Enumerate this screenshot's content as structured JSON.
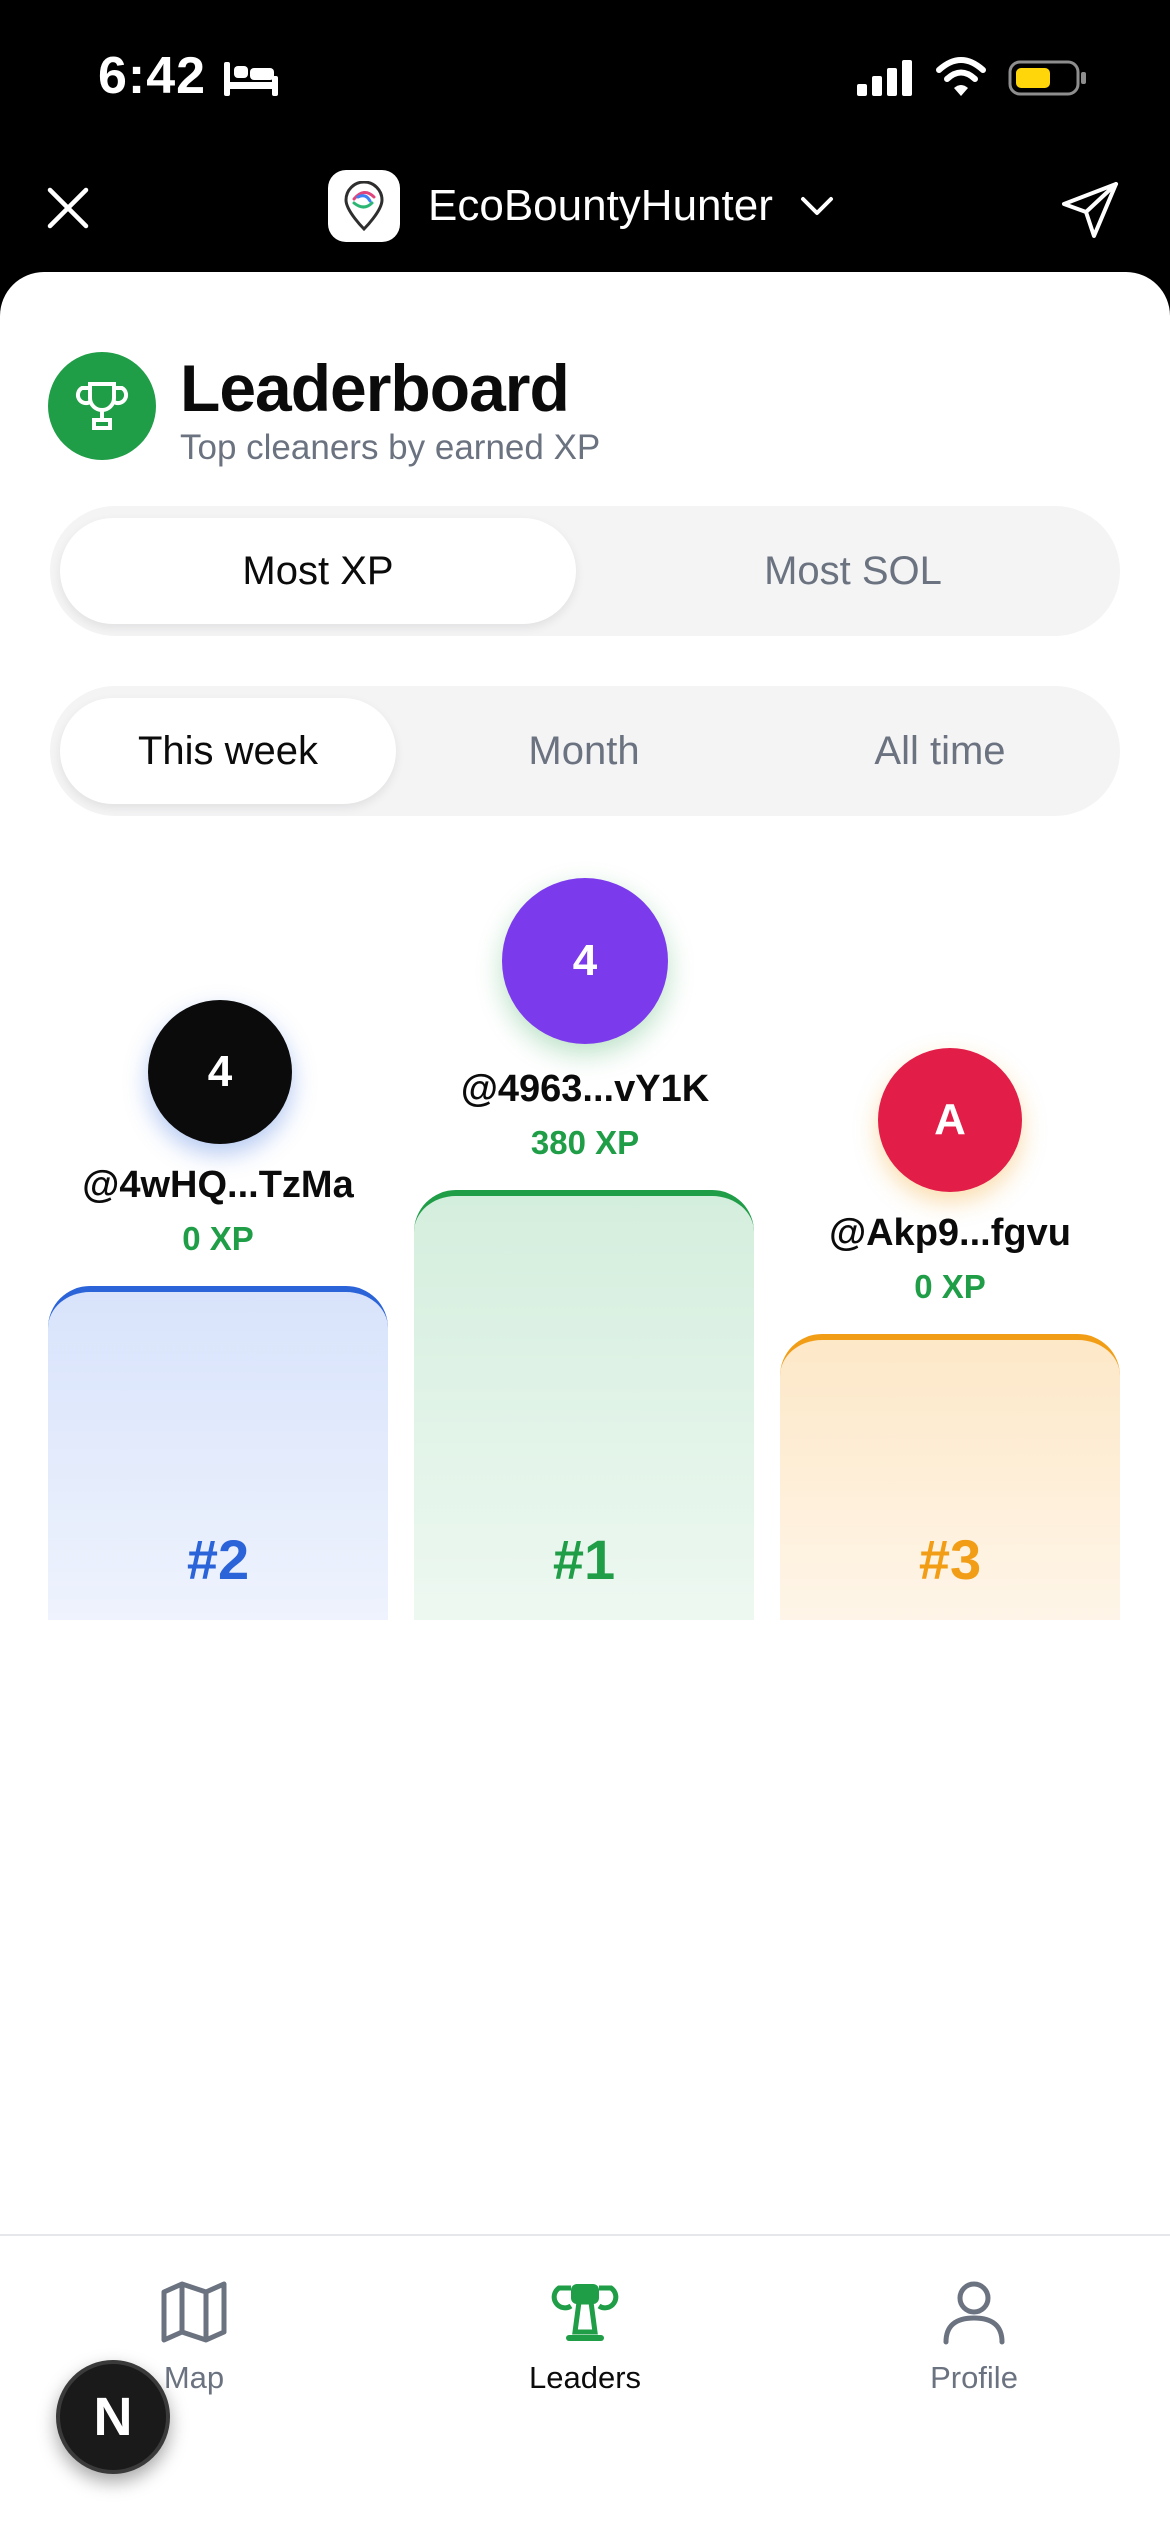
{
  "status_bar": {
    "time": "6:42"
  },
  "header": {
    "app_name": "EcoBountyHunter"
  },
  "page": {
    "title": "Leaderboard",
    "subtitle": "Top cleaners by earned XP"
  },
  "metric_tabs": [
    {
      "label": "Most XP",
      "active": true
    },
    {
      "label": "Most SOL",
      "active": false
    }
  ],
  "period_tabs": [
    {
      "label": "This week",
      "active": true
    },
    {
      "label": "Month",
      "active": false
    },
    {
      "label": "All time",
      "active": false
    }
  ],
  "podium": {
    "first": {
      "initial": "4",
      "name": "@4963...vY1K",
      "xp": "380 XP",
      "rank": "#1",
      "avatar_color": "#7c3aed",
      "accent": "#1f9d47"
    },
    "second": {
      "initial": "4",
      "name": "@4wHQ...TzMa",
      "xp": "0 XP",
      "rank": "#2",
      "avatar_color": "#0b0b0b",
      "accent": "#2b63d9"
    },
    "third": {
      "initial": "A",
      "name": "@Akp9...fgvu",
      "xp": "0 XP",
      "rank": "#3",
      "avatar_color": "#e11d48",
      "accent": "#f29d16"
    }
  },
  "bottom_nav": [
    {
      "label": "Map",
      "icon": "map-icon",
      "active": false
    },
    {
      "label": "Leaders",
      "icon": "trophy-icon",
      "active": true
    },
    {
      "label": "Profile",
      "icon": "user-icon",
      "active": false
    }
  ],
  "floating_badge": {
    "letter": "N"
  }
}
